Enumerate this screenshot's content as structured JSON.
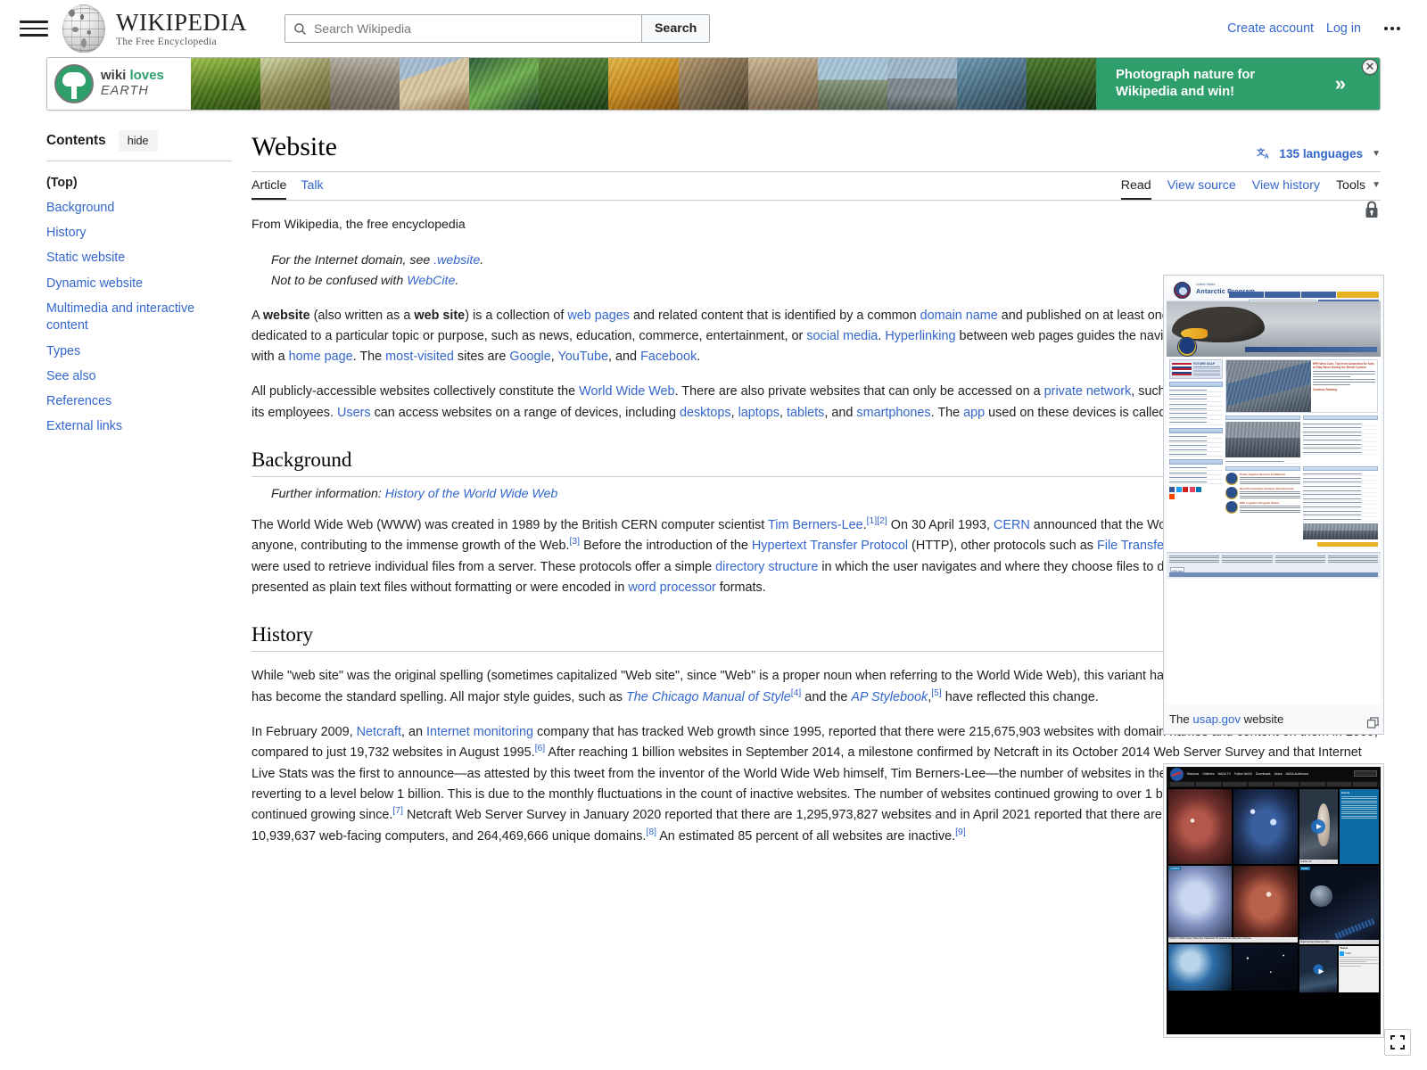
{
  "header": {
    "menu_icon": "hamburger-menu-icon",
    "logo_wordmark": "WIKIPEDIA",
    "logo_tagline": "The Free Encyclopedia",
    "search": {
      "placeholder": "Search Wikipedia",
      "value": "",
      "icon": "search-icon",
      "button_label": "Search"
    },
    "create_account": "Create account",
    "log_in": "Log in",
    "more_icon": "ellipsis-icon"
  },
  "banner": {
    "logo_line1_a": "wiki ",
    "logo_line1_b": "loves",
    "logo_line2": "EARTH",
    "cta_line1": "Photograph nature for",
    "cta_line2": "Wikipedia and win!",
    "chevron": "»",
    "close_icon": "close-circle-icon",
    "accent_color": "#2e9e6b"
  },
  "toc": {
    "title": "Contents",
    "hide_label": "hide",
    "items": [
      {
        "label": "(Top)",
        "top": true
      },
      {
        "label": "Background"
      },
      {
        "label": "History"
      },
      {
        "label": "Static website"
      },
      {
        "label": "Dynamic website"
      },
      {
        "label": "Multimedia and interactive content"
      },
      {
        "label": "Types"
      },
      {
        "label": "See also"
      },
      {
        "label": "References"
      },
      {
        "label": "External links"
      }
    ]
  },
  "article": {
    "title": "Website",
    "languages_label": "135 languages",
    "languages_icon": "language-icon",
    "namespace_tabs": [
      {
        "label": "Article",
        "selected": true
      },
      {
        "label": "Talk",
        "selected": false
      }
    ],
    "view_tabs": [
      {
        "label": "Read",
        "selected": true
      },
      {
        "label": "View source",
        "selected": false
      },
      {
        "label": "View history",
        "selected": false
      },
      {
        "label": "Tools",
        "selected": false,
        "chevron": true
      }
    ],
    "site_sub": "From Wikipedia, the free encyclopedia",
    "protection_icon": "lock-icon",
    "hatnote_1_pre": "For the Internet domain, see ",
    "hatnote_1_link": ".website",
    "hatnote_2_pre": "Not to be confused with ",
    "hatnote_2_link": "WebCite",
    "sections": [
      {
        "heading": "Background",
        "further_info_label": "Further information: ",
        "further_info_link": "History of the World Wide Web"
      },
      {
        "heading": "History"
      }
    ]
  },
  "thumbnails": [
    {
      "caption_pre": "The ",
      "caption_link": "usap.gov",
      "caption_post": " website",
      "expand_icon": "expand-thumbnail-icon",
      "mock": "usap-antarctic-program-website"
    },
    {
      "caption_pre": "",
      "caption_link": "",
      "caption_post": "",
      "expand_icon": "expand-thumbnail-icon",
      "mock": "nasa-gov-website"
    }
  ],
  "fullscreen_button": {
    "icon": "fullscreen-icon"
  },
  "colors": {
    "link": "#3366cc",
    "text": "#202122",
    "border": "#c8ccd1",
    "banner_green": "#2e9e6b"
  }
}
